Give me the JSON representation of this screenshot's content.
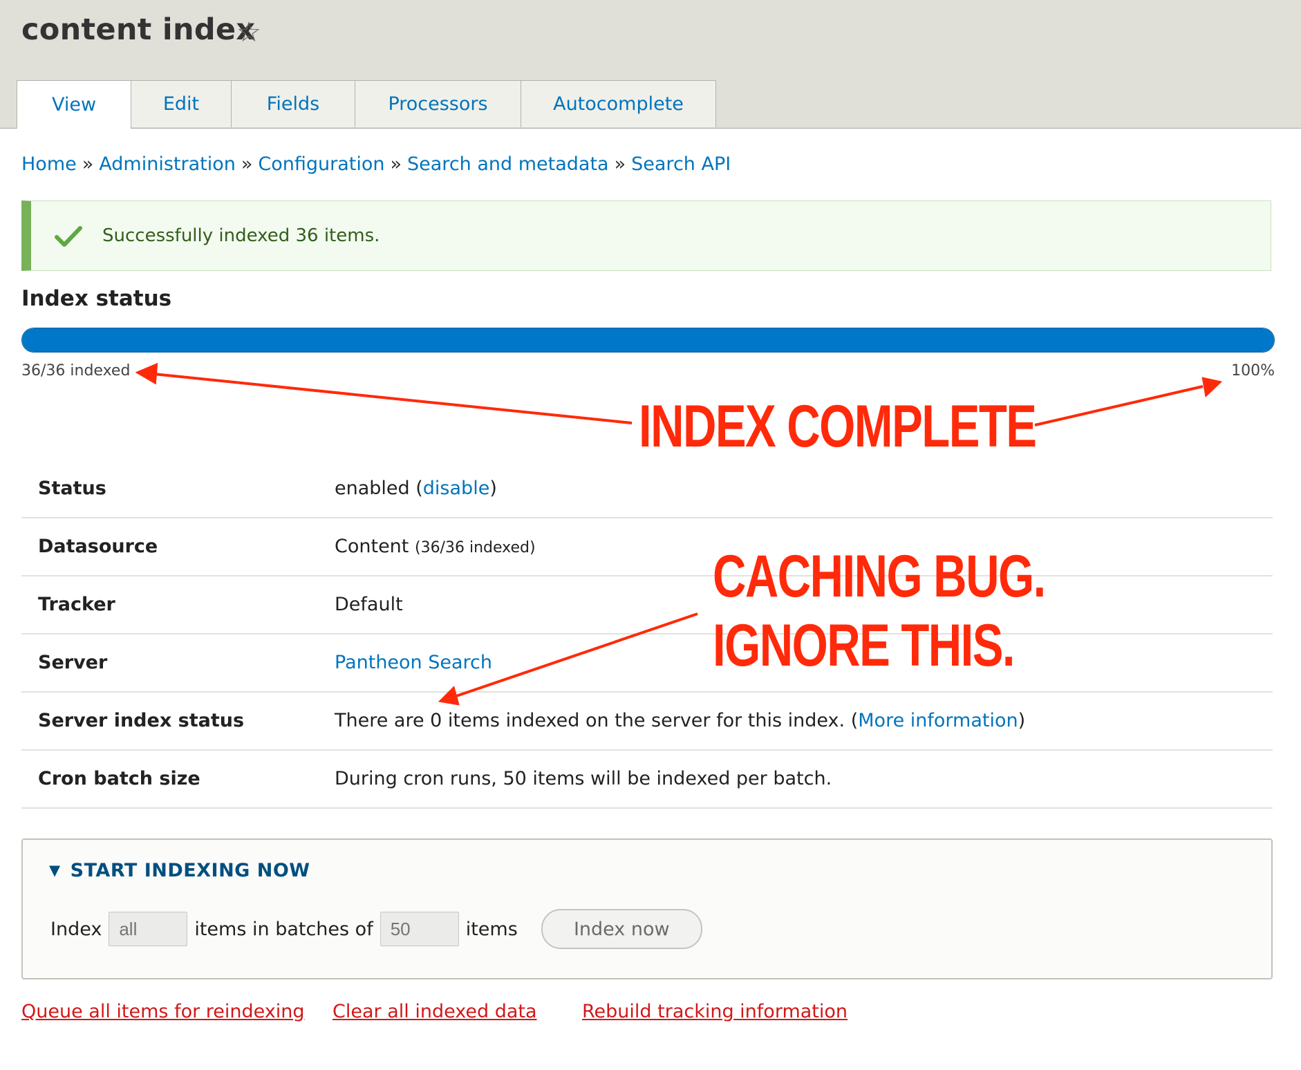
{
  "page": {
    "title": "content index"
  },
  "tabs": [
    {
      "label": "View"
    },
    {
      "label": "Edit"
    },
    {
      "label": "Fields"
    },
    {
      "label": "Processors"
    },
    {
      "label": "Autocomplete"
    }
  ],
  "breadcrumb": [
    {
      "label": "Home"
    },
    {
      "label": "Administration"
    },
    {
      "label": "Configuration"
    },
    {
      "label": "Search and metadata"
    },
    {
      "label": "Search API"
    }
  ],
  "breadcrumb_separator": "»",
  "message": {
    "text": "Successfully indexed 36 items.",
    "type": "status",
    "color": "#77b259"
  },
  "section_title": "Index status",
  "progress": {
    "indexed_label": "36/36 indexed",
    "percent_label": "100%",
    "fraction": 1.0,
    "color": "#0077c8"
  },
  "table": {
    "status": {
      "label": "Status",
      "value": "enabled",
      "link": "disable"
    },
    "datasource": {
      "label": "Datasource",
      "value": "Content",
      "detail": "(36/36 indexed)"
    },
    "tracker": {
      "label": "Tracker",
      "value": "Default"
    },
    "server": {
      "label": "Server",
      "link": "Pantheon Search"
    },
    "server_index_status": {
      "label": "Server index status",
      "value": "There are 0 items indexed on the server for this index.",
      "link": "More information"
    },
    "cron_batch_size": {
      "label": "Cron batch size",
      "value": "During cron runs, 50 items will be indexed per batch."
    }
  },
  "index_now": {
    "summary": "START INDEXING NOW",
    "index_label": "Index",
    "limit_placeholder": "all",
    "middle_label": "items in batches of",
    "batch_placeholder": "50",
    "items_label": "items",
    "button_label": "Index now"
  },
  "actions": [
    {
      "label": "Queue all items for reindexing"
    },
    {
      "label": "Clear all indexed data"
    },
    {
      "label": "Rebuild tracking information"
    }
  ],
  "annotations": {
    "index_complete": "INDEX COMPLETE",
    "caching_bug_line1": "CACHING BUG.",
    "caching_bug_line2": "IGNORE THIS.",
    "color": "#ff2a0a"
  },
  "icons": {
    "favorite": "star-outline-icon",
    "message": "checkmark-icon",
    "collapse": "triangle-down-icon"
  }
}
